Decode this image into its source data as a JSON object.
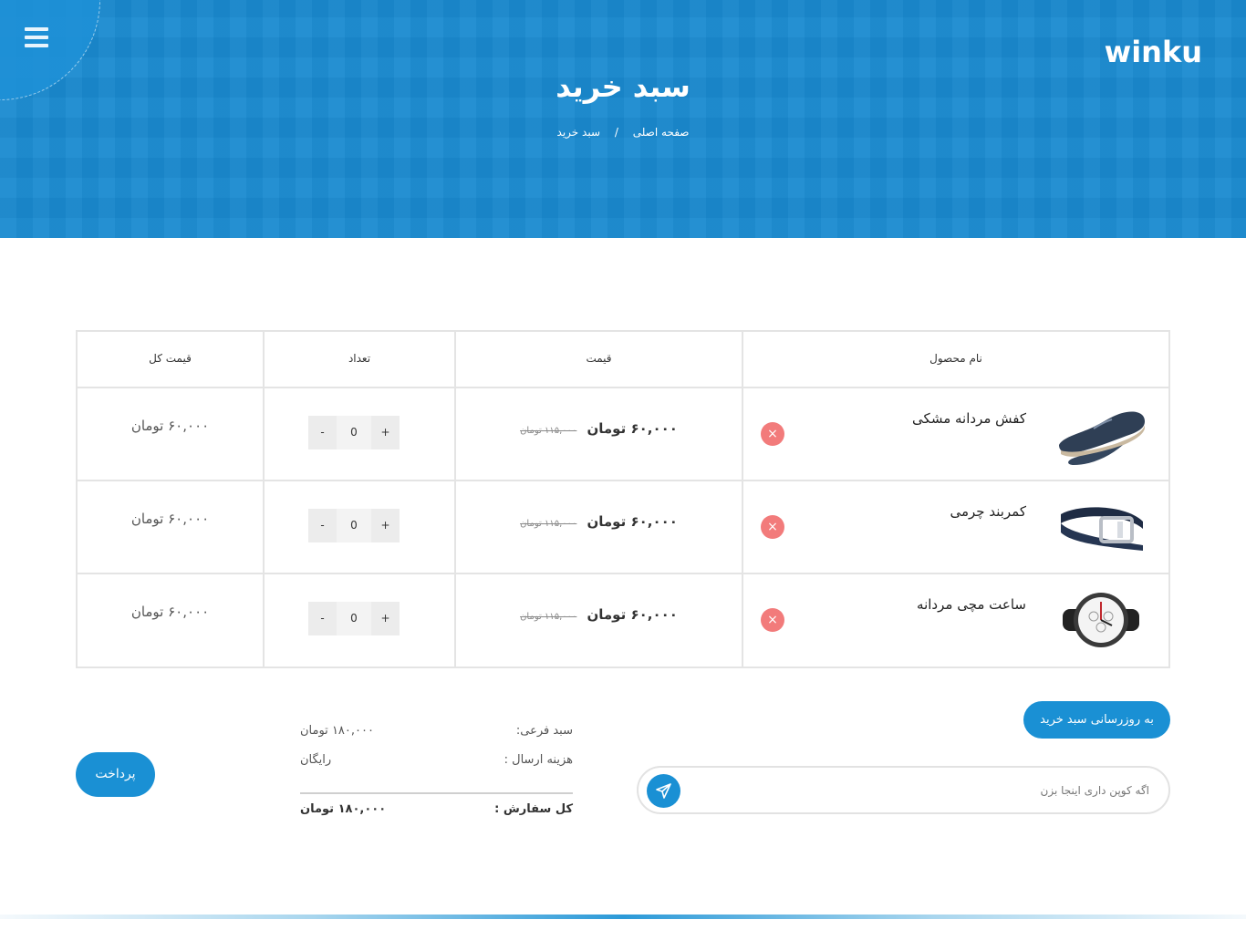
{
  "header": {
    "logo": "winku",
    "page_title": "سبد خرید",
    "breadcrumb": {
      "home": "صفحه اصلی",
      "separator": "/",
      "current": "سبد خرید"
    }
  },
  "table": {
    "columns": {
      "product": "نام محصول",
      "price": "قیمت",
      "quantity": "تعداد",
      "total": "قیمت کل"
    },
    "rows": [
      {
        "name": "کفش مردانه مشکی",
        "image_icon": "shoe-image",
        "old_price": "۱۱۵,۰۰۰ تومان",
        "price": "۶۰,۰۰۰ تومان",
        "quantity": "0",
        "total": "۶۰,۰۰۰ تومان"
      },
      {
        "name": "کمربند چرمی",
        "image_icon": "belt-image",
        "old_price": "۱۱۵,۰۰۰ تومان",
        "price": "۶۰,۰۰۰ تومان",
        "quantity": "0",
        "total": "۶۰,۰۰۰ تومان"
      },
      {
        "name": "ساعت مچی مردانه",
        "image_icon": "watch-image",
        "old_price": "۱۱۵,۰۰۰ تومان",
        "price": "۶۰,۰۰۰ تومان",
        "quantity": "0",
        "total": "۶۰,۰۰۰ تومان"
      }
    ],
    "minus_label": "-",
    "plus_label": "+",
    "remove_label": "×"
  },
  "actions": {
    "update_cart": "به روزرسانی سبد خرید",
    "coupon_placeholder": "اگه کوپن داری اینجا بزن",
    "pay": "پرداخت"
  },
  "summary": {
    "subtotal_label": "سبد فرعی:",
    "subtotal_value": "۱۸۰,۰۰۰ تومان",
    "shipping_label": "هزینه ارسال :",
    "shipping_value": "رایگان",
    "total_label": "کل سفارش :",
    "total_value": "۱۸۰,۰۰۰ تومان"
  },
  "colors": {
    "accent": "#1a90d4",
    "hero": "#1e8fd3",
    "remove": "#f27b7b",
    "border": "#e4e4e4"
  }
}
